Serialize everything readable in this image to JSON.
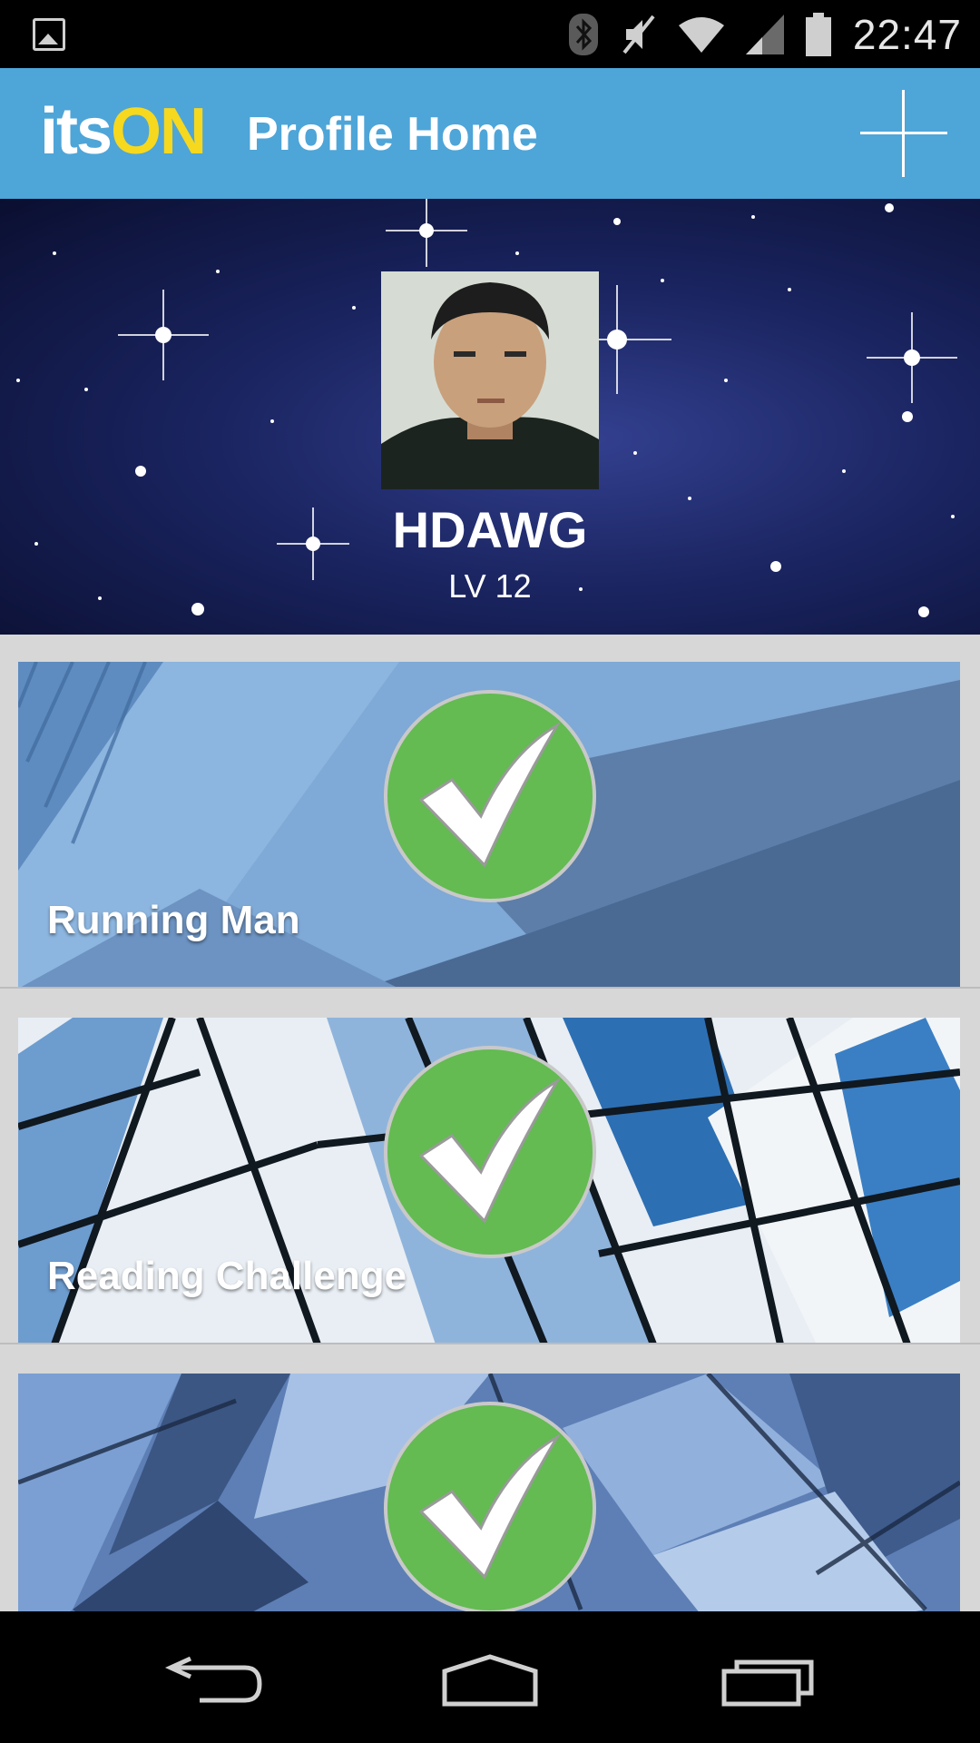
{
  "status_bar": {
    "time": "22:47",
    "icons": [
      "gallery-notification-icon",
      "bluetooth-icon",
      "mute-icon",
      "wifi-icon",
      "signal-icon",
      "battery-icon"
    ]
  },
  "app_bar": {
    "logo_its": "its",
    "logo_on": "ON",
    "title": "Profile Home",
    "add_icon": "plus-icon",
    "colors": {
      "bar": "#4ea5d8",
      "logo_on": "#f6d81f"
    }
  },
  "profile": {
    "username": "HDAWG",
    "level": "LV 12"
  },
  "challenges": [
    {
      "title": "Running Man",
      "completed": true
    },
    {
      "title": "Reading Challenge",
      "completed": true
    },
    {
      "title": "",
      "completed": true
    }
  ],
  "check_color": "#63bb51",
  "nav_bar": {
    "icons": [
      "back-icon",
      "home-icon",
      "recent-apps-icon"
    ]
  }
}
